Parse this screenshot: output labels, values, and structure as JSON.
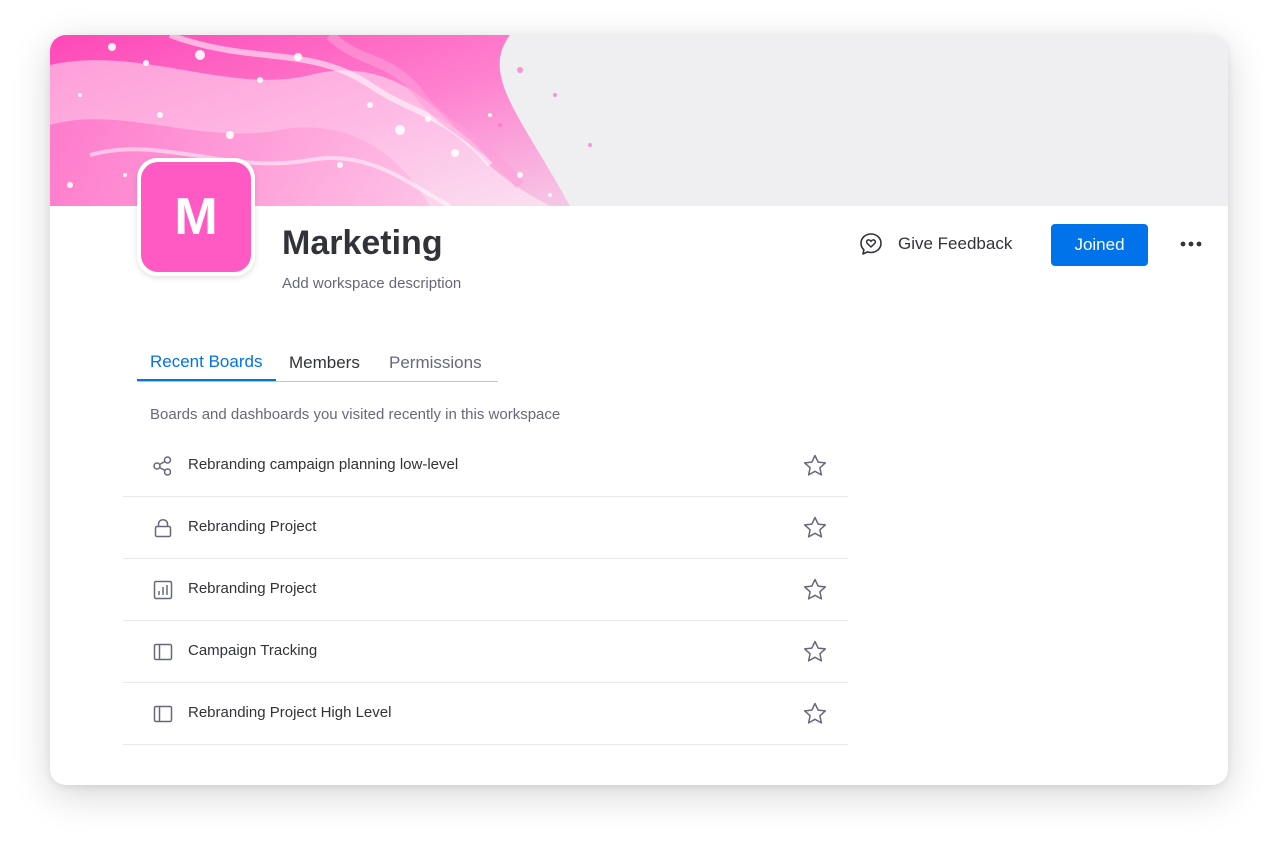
{
  "workspace": {
    "avatar_letter": "M",
    "avatar_color": "#ff5ac4",
    "title": "Marketing",
    "description_placeholder": "Add workspace description"
  },
  "header": {
    "feedback_label": "Give Feedback",
    "feedback_icon": "heart-chat-icon",
    "joined_label": "Joined",
    "more_icon": "more-dots-icon"
  },
  "tabs": [
    {
      "label": "Recent Boards",
      "active": true
    },
    {
      "label": "Members",
      "active": false
    },
    {
      "label": "Permissions",
      "active": false
    }
  ],
  "section_caption": "Boards and dashboards you visited recently in this workspace",
  "boards": [
    {
      "name": "Rebranding campaign planning low-level",
      "icon": "shareable-board-icon"
    },
    {
      "name": "Rebranding Project",
      "icon": "private-board-icon"
    },
    {
      "name": "Rebranding Project",
      "icon": "dashboard-icon"
    },
    {
      "name": "Campaign Tracking",
      "icon": "board-icon"
    },
    {
      "name": "Rebranding Project High Level",
      "icon": "board-icon"
    }
  ],
  "colors": {
    "accent": "#0073ea",
    "text_primary": "#323338",
    "text_secondary": "#676879",
    "divider": "#e6e9ef"
  }
}
